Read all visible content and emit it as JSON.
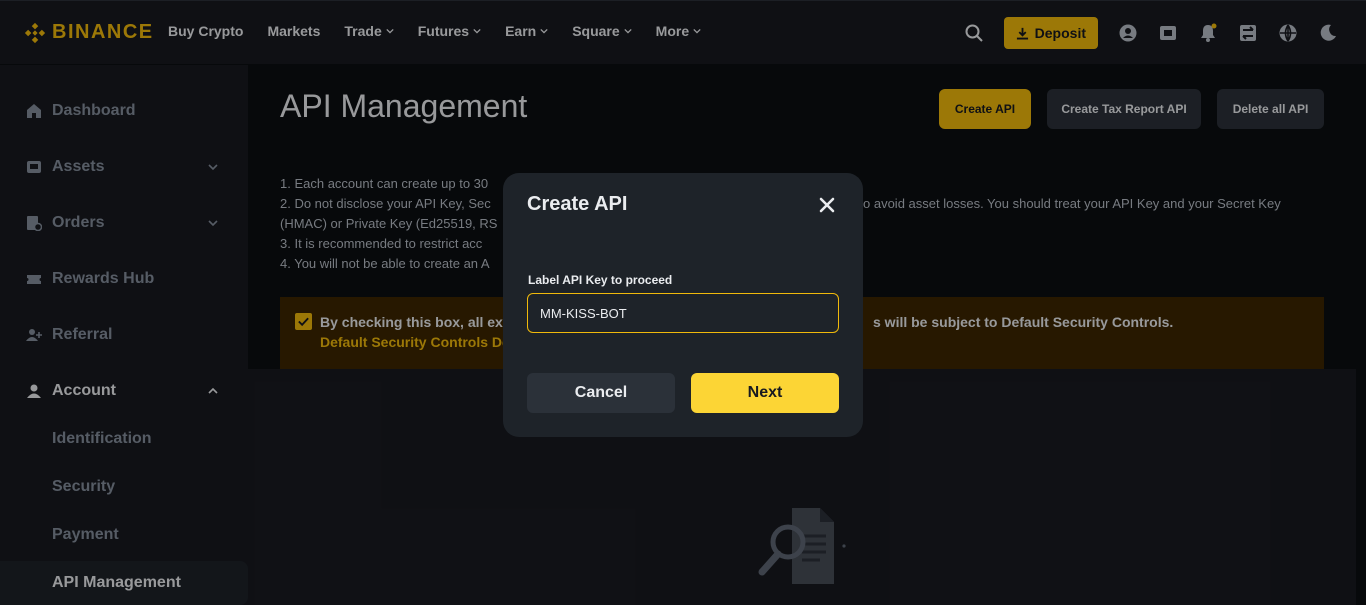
{
  "nav": {
    "brand": "BINANCE",
    "links": [
      {
        "label": "Buy Crypto",
        "dropdown": false
      },
      {
        "label": "Markets",
        "dropdown": false
      },
      {
        "label": "Trade",
        "dropdown": true
      },
      {
        "label": "Futures",
        "dropdown": true
      },
      {
        "label": "Earn",
        "dropdown": true
      },
      {
        "label": "Square",
        "dropdown": true
      },
      {
        "label": "More",
        "dropdown": true
      }
    ],
    "deposit_label": "Deposit",
    "icons": [
      "search-icon",
      "download-icon",
      "user-icon",
      "wallet-icon",
      "bell-icon",
      "transfer-icon",
      "globe-icon",
      "moon-icon"
    ]
  },
  "sidebar": {
    "items": [
      {
        "label": "Dashboard",
        "icon": "home-icon"
      },
      {
        "label": "Assets",
        "icon": "wallet-icon"
      },
      {
        "label": "Orders",
        "icon": "orders-icon"
      },
      {
        "label": "Rewards Hub",
        "icon": "ticket-icon"
      },
      {
        "label": "Referral",
        "icon": "add-user-icon"
      },
      {
        "label": "Account",
        "icon": "user-icon"
      }
    ],
    "sub_items": [
      {
        "label": "Identification"
      },
      {
        "label": "Security"
      },
      {
        "label": "Payment"
      },
      {
        "label": "API Management"
      }
    ]
  },
  "main": {
    "title": "API Management",
    "buttons": {
      "create": "Create API",
      "tax": "Create Tax Report API",
      "delete_all": "Delete all API"
    },
    "notes": [
      "1. Each account can create up to 30",
      "2. Do not disclose your API Key, Sec",
      "(HMAC) or Private Key (Ed25519, RS",
      "3. It is recommended to restrict acc",
      "4. You will not be able to create an A"
    ],
    "notes_right": "o avoid asset losses. You should treat your API Key and your Secret Key",
    "consent": {
      "checked": true,
      "text_left": "By checking this box, all exis",
      "text_right": "s will be subject to Default Security Controls.",
      "link": "Default Security Controls Det"
    }
  },
  "modal": {
    "title": "Create API",
    "field_label": "Label API Key to proceed",
    "field_value": "MM-KISS-BOT",
    "cancel_label": "Cancel",
    "next_label": "Next"
  },
  "colors": {
    "accent": "#f0b90b",
    "primary_button": "#fcd535",
    "background": "#0b0e11",
    "panel": "#181a20",
    "modal": "#1e2329"
  }
}
